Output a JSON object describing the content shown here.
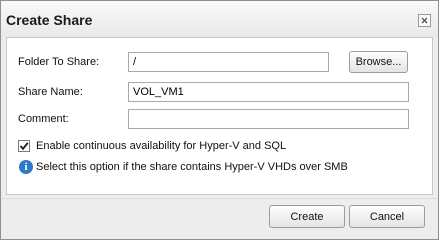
{
  "dialog": {
    "title": "Create Share",
    "close_icon": "close-icon"
  },
  "form": {
    "folder_label": "Folder To Share:",
    "folder_value": "/",
    "browse_label": "Browse...",
    "share_name_label": "Share Name:",
    "share_name_value": "VOL_VM1",
    "comment_label": "Comment:",
    "comment_value": "",
    "availability_label": "Enable continuous availability for Hyper-V and SQL",
    "availability_checked": true,
    "info_icon": "info-icon",
    "info_text": "Select this option if the share contains Hyper-V VHDs over SMB"
  },
  "footer": {
    "create_label": "Create",
    "cancel_label": "Cancel"
  }
}
